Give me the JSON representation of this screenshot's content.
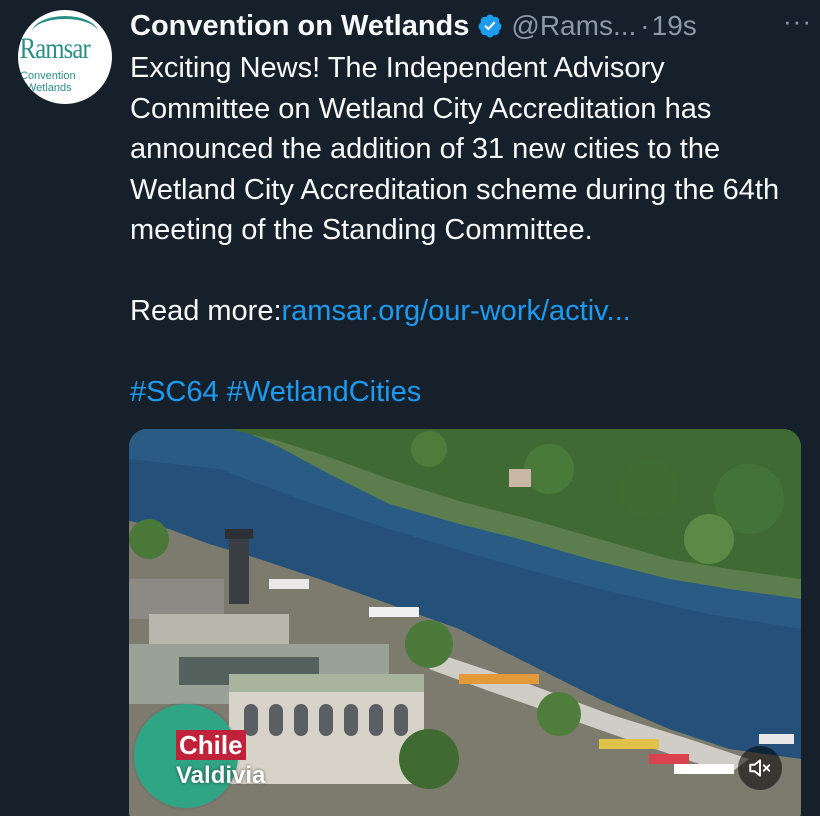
{
  "author": {
    "name": "Convention on Wetlands",
    "handle": "@Rams...",
    "separator": "·",
    "time": "19s",
    "more_label": "···",
    "verified_color": "#1d9bf0",
    "avatar": {
      "brand": "Ramsar",
      "sub1": "Convention",
      "sub2": "Wetlands",
      "color": "#2a8f86"
    }
  },
  "tweet": {
    "paragraph1": "Exciting News! The Independent Advisory Committee on Wetland City Accreditation has announced the addition of 31 new cities to the Wetland City Accreditation scheme during the 64th meeting of the Standing Committee.",
    "read_more_label": "Read more:",
    "read_more_link": "ramsar.org/our-work/activ...",
    "hashtag1": "#SC64",
    "hashtag2": "#WetlandCities",
    "link_color": "#1d9bf0"
  },
  "media": {
    "badge_country": "Chile",
    "badge_city": "Valdivia",
    "mute_icon": "mute-icon"
  }
}
